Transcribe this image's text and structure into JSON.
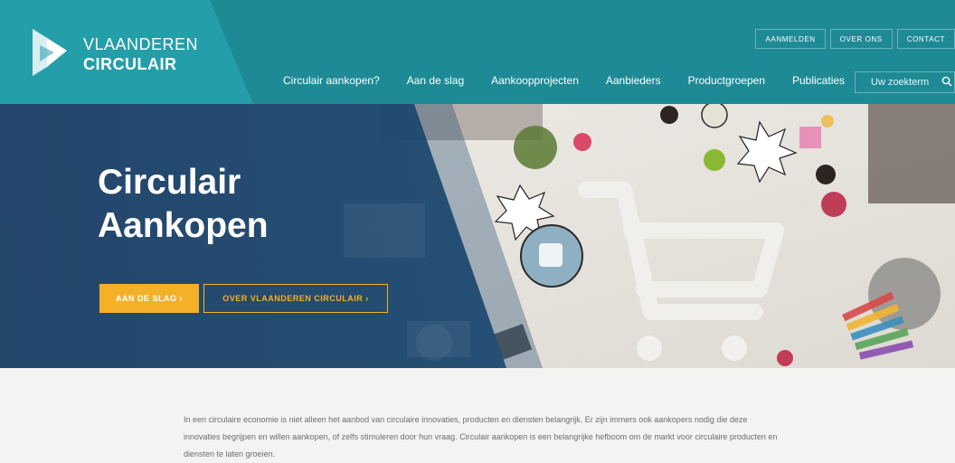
{
  "brand": {
    "line1": "VLAANDEREN",
    "line2": "CIRCULAIR"
  },
  "utility_nav": [
    "AANMELDEN",
    "OVER ONS",
    "CONTACT"
  ],
  "main_nav": [
    "Circulair aankopen?",
    "Aan de slag",
    "Aankoopprojecten",
    "Aanbieders",
    "Productgroepen",
    "Publicaties"
  ],
  "search": {
    "placeholder": "Uw zoekterm",
    "icon": "search-icon"
  },
  "hero": {
    "title_line1": "Circulair",
    "title_line2": "Aankopen",
    "primary_button": "AAN DE SLAG ›",
    "secondary_button": "OVER VLAANDEREN CIRCULAIR ›"
  },
  "intro": {
    "text": "In een circulaire economie is niet alleen het aanbod van circulaire innovaties, producten en diensten belangrijk. Er zijn immers ook aankopers nodig die deze innovaties begrijpen en willen aankopen, of zelfs stimuleren door hun vraag. Circulair aankopen is een belangrijke hefboom om de markt voor circulaire producten en diensten te laten groeien."
  },
  "colors": {
    "header_teal": "#1e8a96",
    "logo_teal": "#249ea9",
    "hero_navy": "#1c4066",
    "accent_yellow": "#f4b128",
    "intro_bg": "#f3f3f1"
  }
}
